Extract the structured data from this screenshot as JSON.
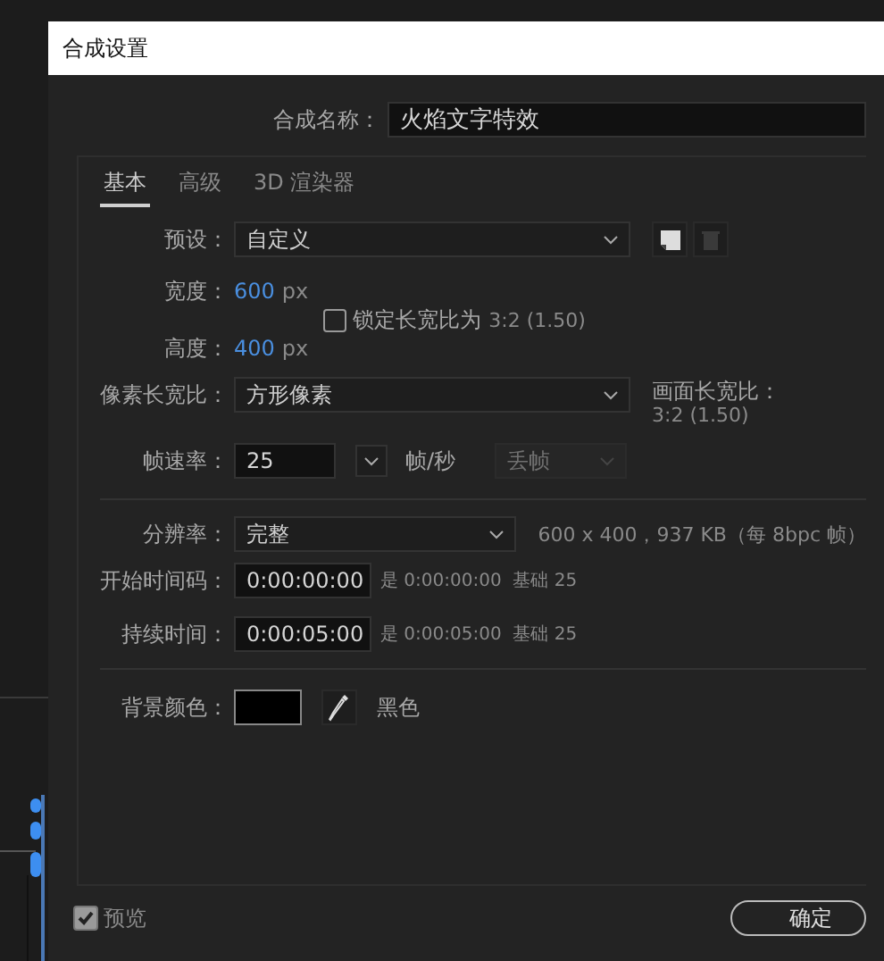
{
  "window": {
    "title": "合成设置"
  },
  "comp_name": {
    "label": "合成名称：",
    "value": "火焰文字特效"
  },
  "tabs": [
    {
      "label": "基本",
      "selected": true
    },
    {
      "label": "高级",
      "selected": false
    },
    {
      "label": "3D 渲染器",
      "selected": false
    }
  ],
  "preset": {
    "label": "预设：",
    "value": "自定义"
  },
  "width": {
    "label": "宽度：",
    "value": "600",
    "unit": "px"
  },
  "lock_aspect": {
    "label": "锁定长宽比为",
    "ratio": "3:2 (1.50)",
    "checked": false
  },
  "height": {
    "label": "高度：",
    "value": "400",
    "unit": "px"
  },
  "pixel_aspect": {
    "label": "像素长宽比：",
    "value": "方形像素"
  },
  "frame_aspect": {
    "label": "画面长宽比：",
    "value": "3:2 (1.50)"
  },
  "frame_rate": {
    "label": "帧速率：",
    "value": "25",
    "unit": "帧/秒",
    "drop_frame": {
      "value": "丢帧",
      "disabled": true
    }
  },
  "resolution": {
    "label": "分辨率：",
    "value": "完整",
    "info": "600 x 400，937 KB（每 8bpc 帧）"
  },
  "start_timecode": {
    "label": "开始时间码：",
    "value": "0:00:00:00",
    "info": "是 0:00:00:00  基础 25"
  },
  "duration": {
    "label": "持续时间：",
    "value": "0:00:05:00",
    "info": "是 0:00:05:00  基础 25"
  },
  "background_color": {
    "label": "背景颜色：",
    "color": "#000000",
    "name": "黑色"
  },
  "preview": {
    "label": "预览",
    "checked": true
  },
  "ok_button": "确定"
}
